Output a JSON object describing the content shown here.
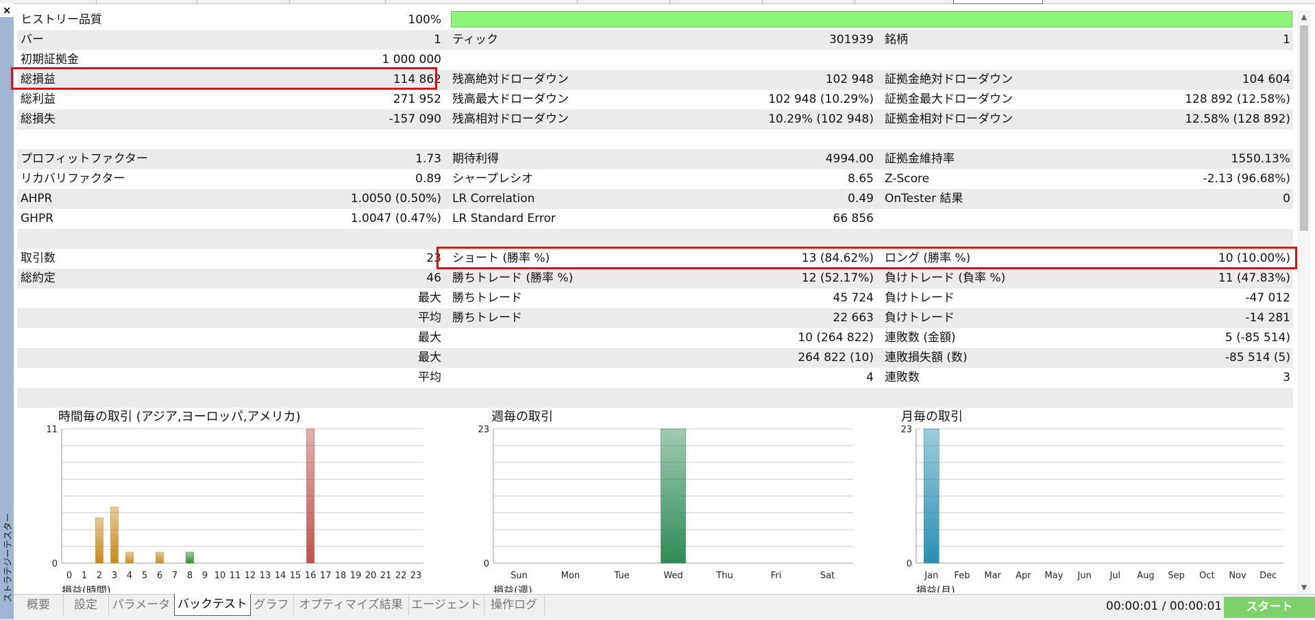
{
  "sidebar": {
    "close_icon": "close-icon",
    "close_glyph": "×",
    "title": "ストラテジーテスター"
  },
  "report": {
    "rows": [
      {
        "l1": "ヒストリー品質",
        "v1": "100%"
      },
      {
        "l1": "バー",
        "v1": "1",
        "l2": "ティック",
        "v2": "301939",
        "l3": "銘柄",
        "v3": "1"
      },
      {
        "l1": "初期証拠金",
        "v1": "1 000 000"
      },
      {
        "l1": "総損益",
        "v1": "114 862",
        "l2": "残高絶対ドローダウン",
        "v2": "102 948",
        "l3": "証拠金絶対ドローダウン",
        "v3": "104 604"
      },
      {
        "l1": "総利益",
        "v1": "271 952",
        "l2": "残高最大ドローダウン",
        "v2": "102 948 (10.29%)",
        "l3": "証拠金最大ドローダウン",
        "v3": "128 892 (12.58%)"
      },
      {
        "l1": "総損失",
        "v1": "-157 090",
        "l2": "残高相対ドローダウン",
        "v2": "10.29% (102 948)",
        "l3": "証拠金相対ドローダウン",
        "v3": "12.58% (128 892)"
      },
      {},
      {
        "l1": "プロフィットファクター",
        "v1": "1.73",
        "l2": "期待利得",
        "v2": "4994.00",
        "l3": "証拠金維持率",
        "v3": "1550.13%"
      },
      {
        "l1": "リカバリファクター",
        "v1": "0.89",
        "l2": "シャープレシオ",
        "v2": "8.65",
        "l3": "Z-Score",
        "v3": "-2.13 (96.68%)"
      },
      {
        "l1": "AHPR",
        "v1": "1.0050 (0.50%)",
        "l2": "LR Correlation",
        "v2": "0.49",
        "l3": "OnTester 結果",
        "v3": "0"
      },
      {
        "l1": "GHPR",
        "v1": "1.0047 (0.47%)",
        "l2": "LR Standard Error",
        "v2": "66 856"
      },
      {},
      {
        "l1": "取引数",
        "v1": "23",
        "l2": "ショート (勝率 %)",
        "v2": "13 (84.62%)",
        "l3": "ロング (勝率 %)",
        "v3": "10 (10.00%)"
      },
      {
        "l1": "総約定",
        "v1": "46",
        "l2": "勝ちトレード (勝率 %)",
        "v2": "12 (52.17%)",
        "l3": "負けトレード (負率 %)",
        "v3": "11 (47.83%)"
      },
      {
        "v1": "最大",
        "l2": "勝ちトレード",
        "v2": "45 724",
        "l3": "負けトレード",
        "v3": "-47 012"
      },
      {
        "v1": "平均",
        "l2": "勝ちトレード",
        "v2": "22 663",
        "l3": "負けトレード",
        "v3": "-14 281"
      },
      {
        "v1": "最大",
        "v2": "10 (264 822)",
        "l3": "連敗数 (金額)",
        "v3": "5 (-85 514)"
      },
      {
        "v1": "最大",
        "v2": "264 822 (10)",
        "l3": "連敗損失額 (数)",
        "v3": "-85 514 (5)"
      },
      {
        "v1": "平均",
        "v2": "4",
        "l3": "連敗数",
        "v3": "3"
      },
      {}
    ]
  },
  "history_quality_percent": 100,
  "highlight_color": "#e01010",
  "chart_data": [
    {
      "type": "bar",
      "title": "時間毎の取引 (アジア,ヨーロッパ,アメリカ)",
      "xlabel": "損益(時間)",
      "categories": [
        "0",
        "1",
        "2",
        "3",
        "4",
        "5",
        "6",
        "7",
        "8",
        "9",
        "10",
        "11",
        "12",
        "13",
        "14",
        "15",
        "16",
        "17",
        "18",
        "19",
        "20",
        "21",
        "22",
        "23"
      ],
      "values": [
        0,
        0,
        3.7,
        4.6,
        0.9,
        0,
        0.9,
        0,
        0.9,
        0,
        0,
        0,
        0,
        0,
        0,
        0,
        11,
        0,
        0,
        0,
        0,
        0,
        0,
        0
      ],
      "bar_colors": [
        "#c88a1c",
        "#c88a1c",
        "#c88a1c",
        "#c88a1c",
        "#c88a1c",
        "#c88a1c",
        "#c88a1c",
        "#c88a1c",
        "#2e8b2e",
        "#c88a1c",
        "#c88a1c",
        "#c88a1c",
        "#c88a1c",
        "#c88a1c",
        "#c88a1c",
        "#c88a1c",
        "#c0504d",
        "#c88a1c",
        "#c88a1c",
        "#c88a1c",
        "#c88a1c",
        "#c88a1c",
        "#c88a1c",
        "#c88a1c"
      ],
      "ylim": [
        0,
        11
      ],
      "y_ticks": [
        "0",
        "11"
      ],
      "grid": true
    },
    {
      "type": "bar",
      "title": "週毎の取引",
      "xlabel": "損益(週)",
      "categories": [
        "Sun",
        "Mon",
        "Tue",
        "Wed",
        "Thu",
        "Fri",
        "Sat"
      ],
      "values": [
        0,
        0,
        0,
        23,
        0,
        0,
        0
      ],
      "bar_colors": [
        "#2e8b57",
        "#2e8b57",
        "#2e8b57",
        "#2e8b57",
        "#2e8b57",
        "#2e8b57",
        "#2e8b57"
      ],
      "ylim": [
        0,
        23
      ],
      "y_ticks": [
        "0",
        "23"
      ],
      "grid": true
    },
    {
      "type": "bar",
      "title": "月毎の取引",
      "xlabel": "損益(月)",
      "categories": [
        "Jan",
        "Feb",
        "Mar",
        "Apr",
        "May",
        "Jun",
        "Jul",
        "Aug",
        "Sep",
        "Oct",
        "Nov",
        "Dec"
      ],
      "values": [
        23,
        0,
        0,
        0,
        0,
        0,
        0,
        0,
        0,
        0,
        0,
        0
      ],
      "bar_colors": [
        "#2a8fb0",
        "#2a8fb0",
        "#2a8fb0",
        "#2a8fb0",
        "#2a8fb0",
        "#2a8fb0",
        "#2a8fb0",
        "#2a8fb0",
        "#2a8fb0",
        "#2a8fb0",
        "#2a8fb0",
        "#2a8fb0"
      ],
      "ylim": [
        0,
        23
      ],
      "y_ticks": [
        "0",
        "23"
      ],
      "grid": true
    }
  ],
  "bottom": {
    "tabs": [
      {
        "label": "概要",
        "active": false
      },
      {
        "label": "設定",
        "active": false
      },
      {
        "label": "パラメータ",
        "active": false
      },
      {
        "label": "バックテスト",
        "active": true
      },
      {
        "label": "グラフ",
        "active": false
      },
      {
        "label": "オプティマイズ結果",
        "active": false
      },
      {
        "label": "エージェント",
        "active": false
      },
      {
        "label": "操作ログ",
        "active": false
      }
    ],
    "timer": "00:00:01 / 00:00:01",
    "start_label": "スタート",
    "start_color": "#7dd36a"
  }
}
